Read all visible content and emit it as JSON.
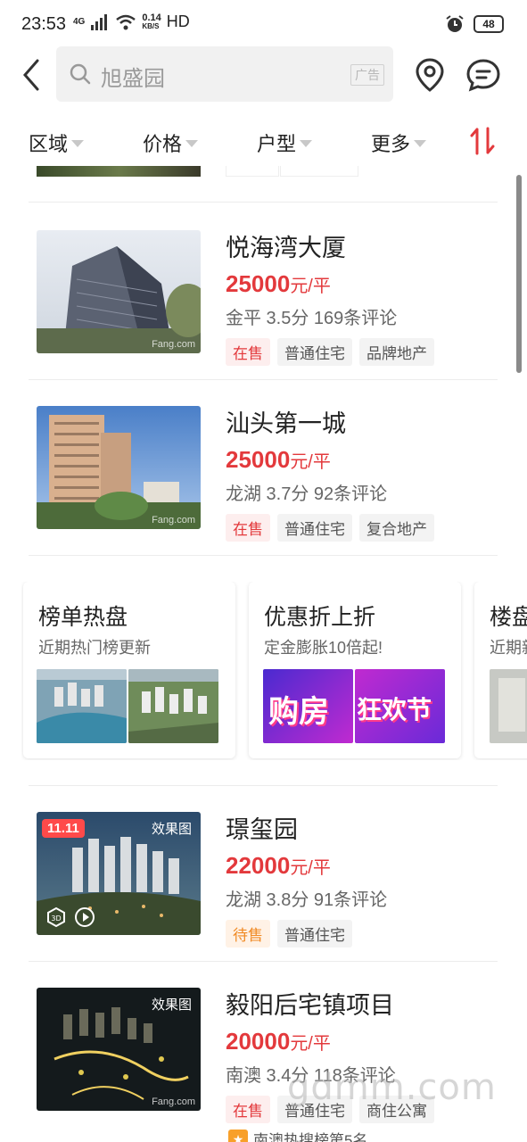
{
  "status_bar": {
    "time": "23:53",
    "net_label": "4G",
    "speed_top": "0.14",
    "speed_bottom": "KB/S",
    "hd": "HD",
    "battery": "48"
  },
  "search": {
    "query": "旭盛园",
    "ad_tag": "广告"
  },
  "filters": [
    {
      "label": "区域"
    },
    {
      "label": "价格"
    },
    {
      "label": "户型"
    },
    {
      "label": "更多"
    }
  ],
  "listings": [
    {
      "name": "悦海湾大厦",
      "price": "25000",
      "unit": "元/平",
      "meta": "金平  3.5分  169条评论",
      "tags": [
        "在售",
        "普通住宅",
        "品牌地产"
      ],
      "thumb_watermark": "Fang.com"
    },
    {
      "name": "汕头第一城",
      "price": "25000",
      "unit": "元/平",
      "meta": "龙湖  3.7分  92条评论",
      "tags": [
        "在售",
        "普通住宅",
        "复合地产"
      ],
      "thumb_watermark": "Fang.com"
    },
    {
      "name": "璟玺园",
      "price": "22000",
      "unit": "元/平",
      "meta": "龙湖  3.8分  91条评论",
      "tags": [
        "待售",
        "普通住宅"
      ],
      "badge": "11.11",
      "effect_label": "效果图"
    },
    {
      "name": "毅阳后宅镇项目",
      "price": "20000",
      "unit": "元/平",
      "meta": "南澳  3.4分  118条评论",
      "tags": [
        "在售",
        "普通住宅",
        "商住公寓"
      ],
      "effect_label": "效果图",
      "thumb_watermark": "Fang.com"
    }
  ],
  "cards": [
    {
      "title": "榜单热盘",
      "subtitle": "近期热门榜更新"
    },
    {
      "title": "优惠折上折",
      "subtitle": "定金膨胀10倍起!",
      "img_text_1": "购房",
      "img_text_2": "狂欢节"
    },
    {
      "title": "楼盘",
      "subtitle": "近期新"
    }
  ],
  "bottom_hint": "南澳热搜榜第5名",
  "site_watermark": "gdmm.com",
  "colors": {
    "accent_red": "#e3393c",
    "presale_orange": "#f08a24",
    "badge_red": "#ff4a4a"
  }
}
